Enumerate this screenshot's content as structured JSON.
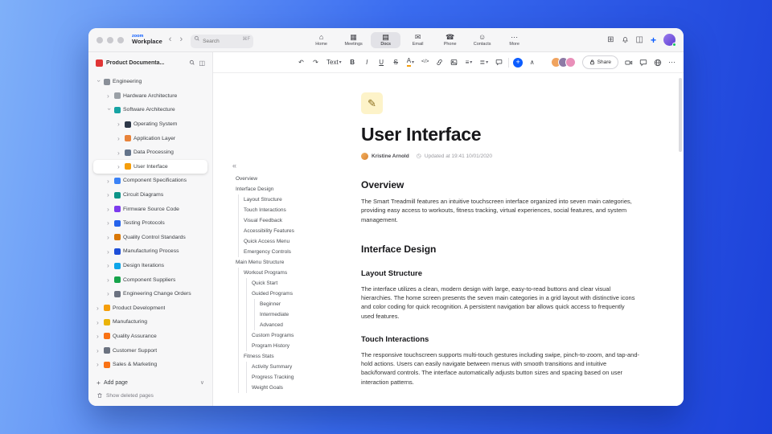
{
  "chrome": {
    "logo_top": "zoom",
    "logo_bottom": "Workplace",
    "back_glyph": "‹",
    "forward_glyph": "›",
    "search_placeholder": "Search",
    "search_shortcut": "⌘F",
    "apps_glyph": "⊞",
    "panel_glyph": "◫",
    "plus_glyph": "+",
    "tabs": [
      {
        "name": "tab-home",
        "icon": "⌂",
        "label": "Home"
      },
      {
        "name": "tab-meetings",
        "icon": "▦",
        "label": "Meetings"
      },
      {
        "name": "tab-docs",
        "icon": "▤",
        "label": "Docs",
        "active": true
      },
      {
        "name": "tab-email",
        "icon": "✉",
        "label": "Email"
      },
      {
        "name": "tab-phone",
        "icon": "☎",
        "label": "Phone"
      },
      {
        "name": "tab-contacts",
        "icon": "☺",
        "label": "Contacts"
      },
      {
        "name": "tab-more",
        "icon": "⋯",
        "label": "More"
      }
    ]
  },
  "sidebar": {
    "workspace_title": "Product Documenta...",
    "workspace_icon": "red-book-icon",
    "panel_glyph": "◫",
    "chevron_glyph": "›",
    "add_plus_glyph": "+",
    "add_page_label": "Add page",
    "add_caret_glyph": "∨",
    "show_deleted_label": "Show deleted pages",
    "tree": [
      {
        "name": "sidebar-item-engineering",
        "label": "Engineering",
        "level": 0,
        "expanded": true,
        "icon": "gear-icon",
        "color": "#8a8f98"
      },
      {
        "name": "sidebar-item-hardware-architecture",
        "label": "Hardware Architecture",
        "level": 1,
        "icon": "wrench-icon",
        "color": "#9aa0a6"
      },
      {
        "name": "sidebar-item-software-architecture",
        "label": "Software Architecture",
        "level": 1,
        "expanded": true,
        "icon": "monitor-icon",
        "color": "#16a3a3"
      },
      {
        "name": "sidebar-item-operating-system",
        "label": "Operating System",
        "level": 2,
        "icon": "chip-icon",
        "color": "#2d3748"
      },
      {
        "name": "sidebar-item-application-layer",
        "label": "Application Layer",
        "level": 2,
        "icon": "layers-icon",
        "color": "#e8833a"
      },
      {
        "name": "sidebar-item-data-processing",
        "label": "Data Processing",
        "level": 2,
        "icon": "database-icon",
        "color": "#64748b"
      },
      {
        "name": "sidebar-item-user-interface",
        "label": "User Interface",
        "level": 2,
        "selected": true,
        "icon": "brush-icon",
        "color": "#f59e0b"
      },
      {
        "name": "sidebar-item-component-specifications",
        "label": "Component Specifications",
        "level": 1,
        "icon": "clipboard-icon",
        "color": "#3b82f6"
      },
      {
        "name": "sidebar-item-circuit-diagrams",
        "label": "Circuit Diagrams",
        "level": 1,
        "icon": "circuit-icon",
        "color": "#0d9488"
      },
      {
        "name": "sidebar-item-firmware-source-code",
        "label": "Firmware Source Code",
        "level": 1,
        "icon": "code-icon",
        "color": "#7c3aed"
      },
      {
        "name": "sidebar-item-testing-protocols",
        "label": "Testing Protocols",
        "level": 1,
        "icon": "flask-icon",
        "color": "#2563eb"
      },
      {
        "name": "sidebar-item-quality-control-standards",
        "label": "Quality Control Standards",
        "level": 1,
        "icon": "medal-icon",
        "color": "#d97706"
      },
      {
        "name": "sidebar-item-manufacturing-process",
        "label": "Manufacturing Process",
        "level": 1,
        "icon": "factory-icon",
        "color": "#1d4ed8"
      },
      {
        "name": "sidebar-item-design-iterations",
        "label": "Design Iterations",
        "level": 1,
        "icon": "ruler-icon",
        "color": "#0ea5e9"
      },
      {
        "name": "sidebar-item-component-suppliers",
        "label": "Component Suppliers",
        "level": 1,
        "icon": "box-icon",
        "color": "#16a34a"
      },
      {
        "name": "sidebar-item-engineering-change-orders",
        "label": "Engineering Change Orders",
        "level": 1,
        "icon": "document-icon",
        "color": "#6b7280"
      },
      {
        "name": "sidebar-item-product-development",
        "label": "Product Development",
        "level": 0,
        "icon": "rocket-icon",
        "color": "#f59e0b"
      },
      {
        "name": "sidebar-item-manufacturing",
        "label": "Manufacturing",
        "level": 0,
        "icon": "factory-icon",
        "color": "#eab308"
      },
      {
        "name": "sidebar-item-quality-assurance",
        "label": "Quality Assurance",
        "level": 0,
        "icon": "ribbon-icon",
        "color": "#f97316"
      },
      {
        "name": "sidebar-item-customer-support",
        "label": "Customer Support",
        "level": 0,
        "icon": "chat-icon",
        "color": "#6b7280"
      },
      {
        "name": "sidebar-item-sales-marketing",
        "label": "Sales & Marketing",
        "level": 0,
        "icon": "chart-icon",
        "color": "#f97316"
      }
    ]
  },
  "outline": {
    "collapse_glyph": "«",
    "items": [
      {
        "name": "outline-overview",
        "label": "Overview",
        "level": 0
      },
      {
        "name": "outline-interface-design",
        "label": "Interface Design",
        "level": 0
      },
      {
        "name": "outline-layout-structure",
        "label": "Layout Structure",
        "level": 1
      },
      {
        "name": "outline-touch-interactions",
        "label": "Touch Interactions",
        "level": 1
      },
      {
        "name": "outline-visual-feedback",
        "label": "Visual Feedback",
        "level": 1
      },
      {
        "name": "outline-accessibility-features",
        "label": "Accessibility Features",
        "level": 1
      },
      {
        "name": "outline-quick-access-menu",
        "label": "Quick Access Menu",
        "level": 1
      },
      {
        "name": "outline-emergency-controls",
        "label": "Emergency Controls",
        "level": 1
      },
      {
        "name": "outline-main-menu-structure",
        "label": "Main Menu Structure",
        "level": 0
      },
      {
        "name": "outline-workout-programs",
        "label": "Workout Programs",
        "level": 1
      },
      {
        "name": "outline-quick-start",
        "label": "Quick Start",
        "level": 2
      },
      {
        "name": "outline-guided-programs",
        "label": "Guided Programs",
        "level": 2
      },
      {
        "name": "outline-beginner",
        "label": "Beginner",
        "level": 3
      },
      {
        "name": "outline-intermediate",
        "label": "Intermediate",
        "level": 3
      },
      {
        "name": "outline-advanced",
        "label": "Advanced",
        "level": 3
      },
      {
        "name": "outline-custom-programs",
        "label": "Custom Programs",
        "level": 2
      },
      {
        "name": "outline-program-history",
        "label": "Program History",
        "level": 2
      },
      {
        "name": "outline-fitness-stats",
        "label": "Fitness Stats",
        "level": 1
      },
      {
        "name": "outline-activity-summary",
        "label": "Activity Summary",
        "level": 2
      },
      {
        "name": "outline-progress-tracking",
        "label": "Progress Tracking",
        "level": 2
      },
      {
        "name": "outline-weight-goals",
        "label": "Weight Goals",
        "level": 2
      }
    ]
  },
  "editor": {
    "toolbar": {
      "undo_glyph": "↶",
      "redo_glyph": "↷",
      "text_style": "Text",
      "caret_glyph": "▾",
      "bold": "B",
      "italic": "I",
      "underline": "U",
      "strike": "S",
      "color_letter": "A",
      "inline_code": "</>",
      "align_glyph": "≡",
      "list_glyph": "≣",
      "collapse_glyph": "∧",
      "more_glyph": "⋯"
    },
    "share_label": "Share",
    "collaborators": [
      {
        "name": "collaborator-avatar-1",
        "color": "#f0a35e"
      },
      {
        "name": "collaborator-avatar-2",
        "color": "#8d7aa5"
      },
      {
        "name": "collaborator-avatar-3",
        "color": "#e98fb9"
      }
    ]
  },
  "doc": {
    "icon_glyph": "✎",
    "title": "User Interface",
    "author": "Kristine Arnold",
    "clock_glyph": "◷",
    "updated": "Updated at 19:41 10/01/2020",
    "blocks": [
      {
        "type": "h2",
        "name": "doc-heading-overview",
        "text": "Overview"
      },
      {
        "type": "p",
        "name": "doc-paragraph-overview",
        "text": "The Smart Treadmill features an intuitive touchscreen interface organized into seven main categories, providing easy access to workouts, fitness tracking, virtual experiences, social features, and system management."
      },
      {
        "type": "h2",
        "name": "doc-heading-interface-design",
        "text": "Interface Design"
      },
      {
        "type": "h3",
        "name": "doc-heading-layout-structure",
        "text": "Layout Structure"
      },
      {
        "type": "p",
        "name": "doc-paragraph-layout-structure",
        "text": "The interface utilizes a clean, modern design with large, easy-to-read buttons and clear visual hierarchies. The home screen presents the seven main categories in a grid layout with distinctive icons and color coding for quick recognition. A persistent navigation bar allows quick access to frequently used features."
      },
      {
        "type": "h3",
        "name": "doc-heading-touch-interactions",
        "text": "Touch Interactions"
      },
      {
        "type": "p",
        "name": "doc-paragraph-touch-interactions",
        "text": "The responsive touchscreen supports multi-touch gestures including swipe, pinch-to-zoom, and tap-and-hold actions. Users can easily navigate between menus with smooth transitions and intuitive back/forward controls. The interface automatically adjusts button sizes and spacing based on user interaction patterns."
      }
    ]
  }
}
